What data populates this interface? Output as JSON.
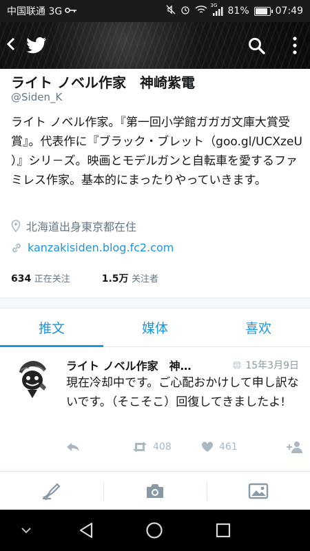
{
  "status_bar": {
    "carrier": "中国联通 3G",
    "signal_label": "3G",
    "battery": "81%",
    "time": "07:49"
  },
  "profile": {
    "name": "ライト ノベル作家　神崎紫電",
    "handle": "@Siden_K",
    "bio": "ライト ノベル作家。『第一回小学館ガガガ文庫大賞受賞』。代表作に『ブラック・ブレット（goo.gl/UCXzeU ）』シリ－ズ。映画とモデルガンと自転車を愛するファミレス作家。基本的にまったりやっていきます。",
    "location": "北海道出身東京都在住",
    "website": "kanzakisiden.blog.fc2.com",
    "following_count": "634",
    "following_label": "正在关注",
    "followers_count": "1.5万",
    "followers_label": "关注者"
  },
  "tabs": [
    {
      "label": "推文",
      "active": true
    },
    {
      "label": "媒体",
      "active": false
    },
    {
      "label": "喜欢",
      "active": false
    }
  ],
  "tweet": {
    "author": "ライト ノベル作家　神…",
    "date": "15年3月9日",
    "text": "現在冷却中です。ご心配おかけして申し訳ないです。（そこそこ）回復してきましたよ!",
    "retweets": "408",
    "likes": "461"
  },
  "colors": {
    "accent": "#1b95e0",
    "muted": "#657786"
  }
}
